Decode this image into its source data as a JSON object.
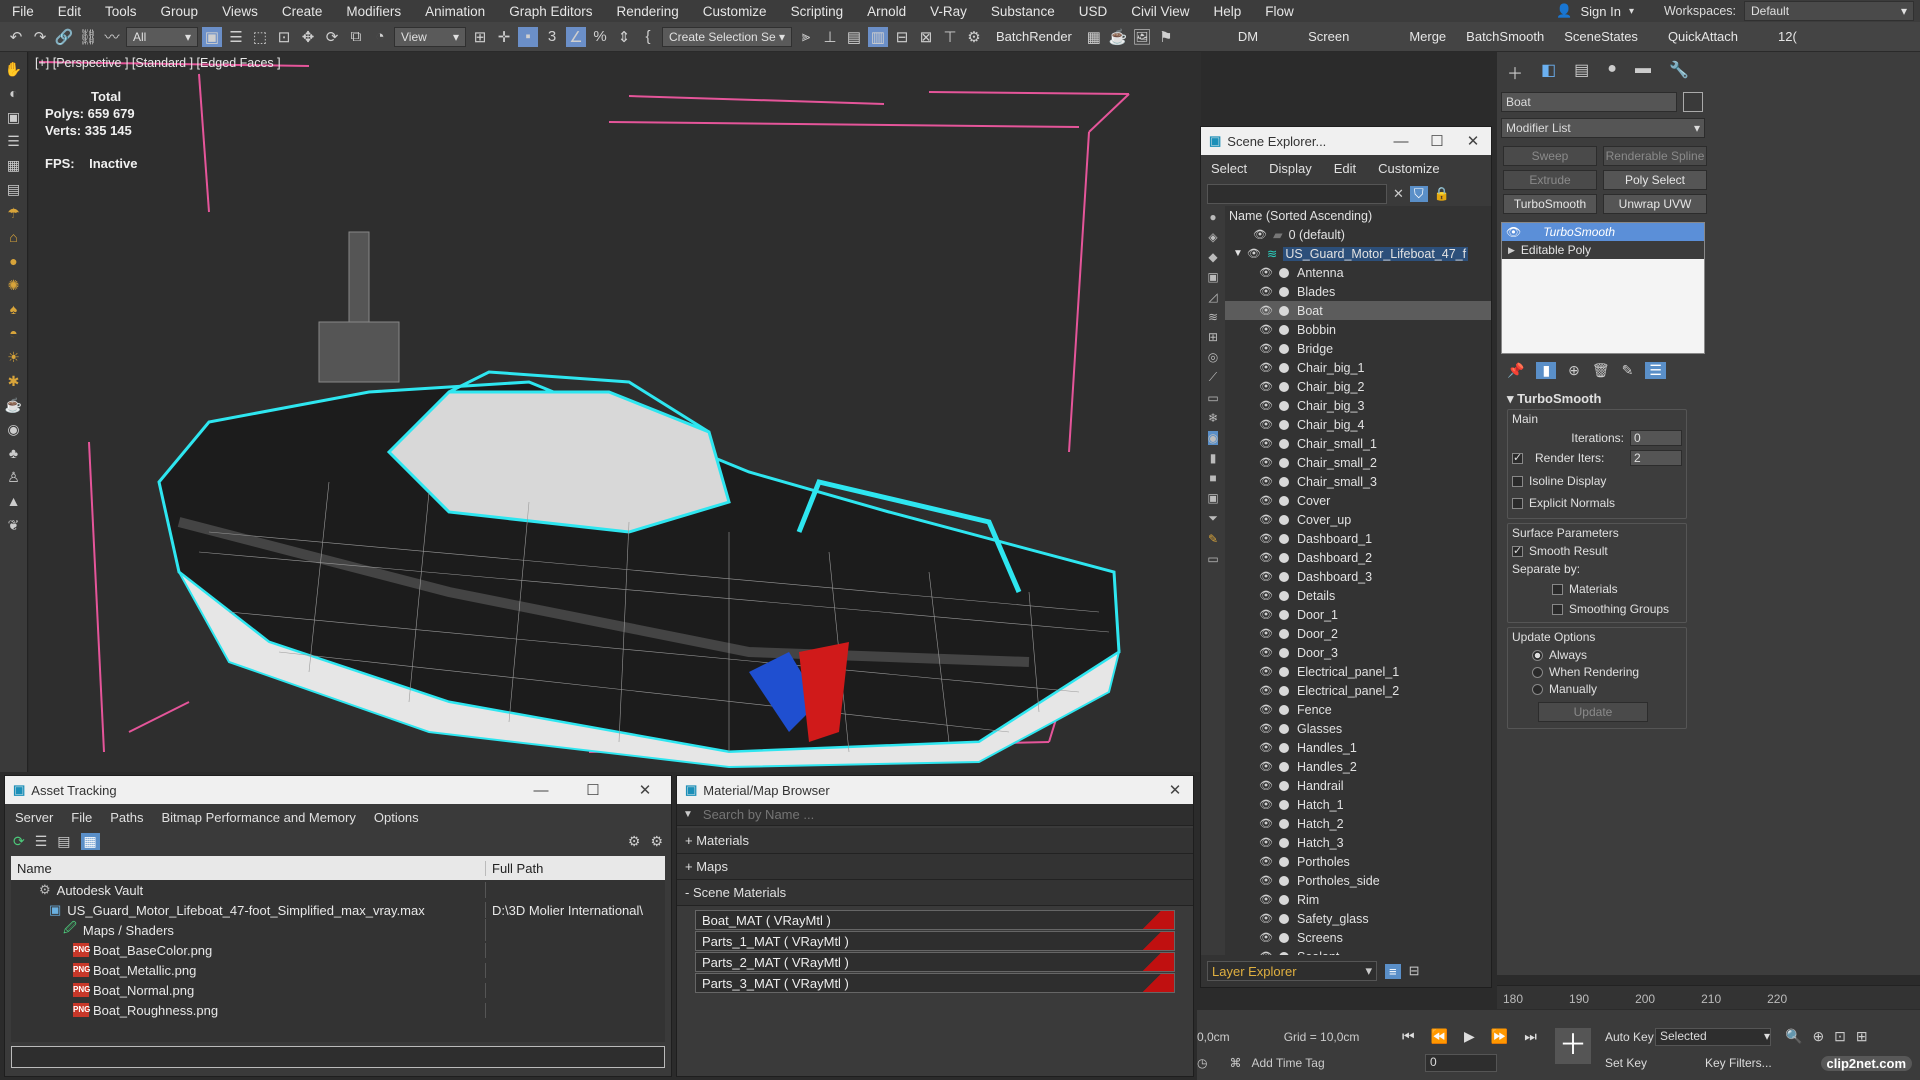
{
  "menubar": {
    "items": [
      "File",
      "Edit",
      "Tools",
      "Group",
      "Views",
      "Create",
      "Modifiers",
      "Animation",
      "Graph Editors",
      "Rendering",
      "Customize",
      "Scripting",
      "Arnold",
      "V-Ray",
      "Substance",
      "USD",
      "Civil View",
      "Help",
      "Flow"
    ],
    "sign_in": "Sign In",
    "workspaces_label": "Workspaces:",
    "workspaces_value": "Default"
  },
  "toolbar": {
    "filter_value": "All",
    "view_value": "View",
    "selection_set": "Create Selection Se",
    "batch_render": "BatchRender",
    "dm": "DM",
    "screen": "Screen",
    "merge": "Merge",
    "batch_smooth": "BatchSmooth",
    "scene_states": "SceneStates",
    "quick_attach": "QuickAttach",
    "overflow": "12("
  },
  "viewport": {
    "label": "[+] [Perspective ] [Standard ] [Edged Faces ]",
    "stats": {
      "total_label": "Total",
      "polys_label": "Polys:",
      "polys_value": "659 679",
      "verts_label": "Verts:",
      "verts_value": "335 145",
      "fps_label": "FPS:",
      "fps_value": "Inactive"
    }
  },
  "scene_explorer": {
    "title": "Scene Explorer...",
    "menu": [
      "Select",
      "Display",
      "Edit",
      "Customize"
    ],
    "column_header": "Name (Sorted Ascending)",
    "root_default": "0 (default)",
    "root_model": "US_Guard_Motor_Lifeboat_47_f",
    "items": [
      "Antenna",
      "Blades",
      "Boat",
      "Bobbin",
      "Bridge",
      "Chair_big_1",
      "Chair_big_2",
      "Chair_big_3",
      "Chair_big_4",
      "Chair_small_1",
      "Chair_small_2",
      "Chair_small_3",
      "Cover",
      "Cover_up",
      "Dashboard_1",
      "Dashboard_2",
      "Dashboard_3",
      "Details",
      "Door_1",
      "Door_2",
      "Door_3",
      "Electrical_panel_1",
      "Electrical_panel_2",
      "Fence",
      "Glasses",
      "Handles_1",
      "Handles_2",
      "Handrail",
      "Hatch_1",
      "Hatch_2",
      "Hatch_3",
      "Portholes",
      "Portholes_side",
      "Rim",
      "Safety_glass",
      "Screens",
      "Sealant"
    ],
    "selected_item": "Boat",
    "footer_label": "Layer Explorer"
  },
  "command_panel": {
    "object_name": "Boat",
    "modifier_list": "Modifier List",
    "buttons": [
      {
        "label": "Sweep",
        "enabled": false
      },
      {
        "label": "Renderable Spline",
        "enabled": false
      },
      {
        "label": "Extrude",
        "enabled": false
      },
      {
        "label": "Poly Select",
        "enabled": true
      },
      {
        "label": "TurboSmooth",
        "enabled": true
      },
      {
        "label": "Unwrap UVW",
        "enabled": true
      }
    ],
    "stack": [
      "TurboSmooth",
      "Editable Poly"
    ],
    "rollout_title": "TurboSmooth",
    "main_label": "Main",
    "iterations_label": "Iterations:",
    "iterations_value": "0",
    "render_iters_label": "Render Iters:",
    "render_iters_value": "2",
    "isoline_display": "Isoline Display",
    "explicit_normals": "Explicit Normals",
    "surface_parameters": "Surface Parameters",
    "smooth_result": "Smooth Result",
    "separate_by": "Separate by:",
    "materials": "Materials",
    "smoothing_groups": "Smoothing Groups",
    "update_options": "Update Options",
    "always": "Always",
    "when_rendering": "When Rendering",
    "manually": "Manually",
    "update_button": "Update"
  },
  "asset_tracking": {
    "title": "Asset Tracking",
    "menu": [
      "Server",
      "File",
      "Paths",
      "Bitmap Performance and Memory",
      "Options"
    ],
    "col_name": "Name",
    "col_path": "Full Path",
    "rows": [
      {
        "name": "Autodesk Vault",
        "path": ""
      },
      {
        "name": "US_Guard_Motor_Lifeboat_47-foot_Simplified_max_vray.max",
        "path": "D:\\3D Molier International\\"
      },
      {
        "name": "Maps / Shaders",
        "path": ""
      },
      {
        "name": "Boat_BaseColor.png",
        "path": ""
      },
      {
        "name": "Boat_Metallic.png",
        "path": ""
      },
      {
        "name": "Boat_Normal.png",
        "path": ""
      },
      {
        "name": "Boat_Roughness.png",
        "path": ""
      }
    ]
  },
  "material_browser": {
    "title": "Material/Map Browser",
    "search_placeholder": "Search by Name ...",
    "sections": [
      "+ Materials",
      "+ Maps",
      "- Scene Materials"
    ],
    "materials": [
      "Boat_MAT  ( VRayMtl )",
      "Parts_1_MAT  ( VRayMtl )",
      "Parts_2_MAT  ( VRayMtl )",
      "Parts_3_MAT  ( VRayMtl )"
    ]
  },
  "status": {
    "timeline_ticks": [
      "180",
      "190",
      "200",
      "210",
      "220"
    ],
    "coord": "0,0cm",
    "grid": "Grid = 10,0cm",
    "add_time_tag": "Add Time Tag",
    "auto_key": "Auto Key",
    "selected": "Selected",
    "set_key": "Set Key",
    "key_filters": "Key Filters...",
    "frame": "0",
    "watermark": "clip2net.com"
  }
}
